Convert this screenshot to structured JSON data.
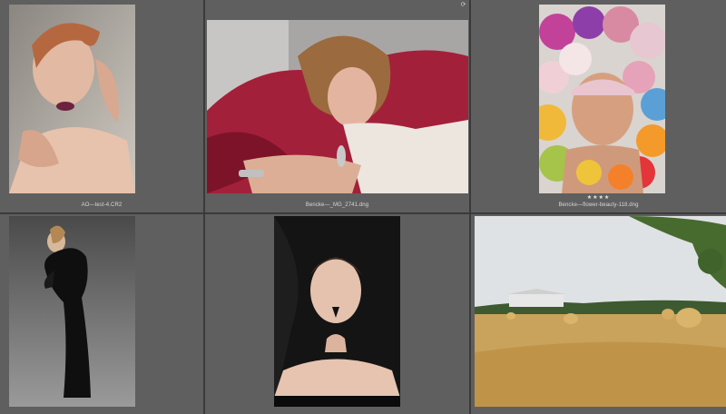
{
  "grid": {
    "cells": [
      {
        "filename": "AO—test-4.CR2",
        "rating": "",
        "subject": "portrait with slicked copper hair"
      },
      {
        "filename": "Bencke—_MG_2741.dng",
        "rating": "",
        "subject": "woman reclining on red fabric"
      },
      {
        "filename": "Bencke—flower-beauty-118.dng",
        "rating": "★★★★",
        "subject": "face surrounded by flowers"
      },
      {
        "filename": "",
        "rating": "",
        "subject": "woman in long black dress"
      },
      {
        "filename": "",
        "rating": "",
        "subject": "woman with painted nose"
      },
      {
        "filename": "",
        "rating": "",
        "subject": "wheat field with hay bales"
      }
    ],
    "badge_icon": "sync-icon"
  },
  "colors": {
    "cell_bg": "#5f5f5f",
    "gutter": "#3a3a3a",
    "label": "#d8d8d8"
  }
}
